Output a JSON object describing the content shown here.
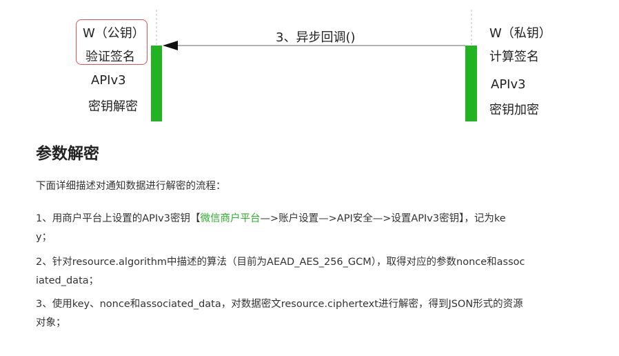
{
  "diagram": {
    "left": {
      "title": "W（公钥）",
      "action": "验证签名",
      "api": "APIv3",
      "op": "密钥解密"
    },
    "right": {
      "title": "W（私钥）",
      "action": "计算签名",
      "api": "APIv3",
      "op": "密钥加密"
    },
    "message": "3、异步回调()",
    "colors": {
      "bar": "#22b322",
      "highlight_border": "#e05252",
      "link": "#2bb02b"
    }
  },
  "section": {
    "title": "参数解密",
    "intro": "下面详细描述对通知数据进行解密的流程：",
    "step1": {
      "pre": "1、用商户平台上设置的APIv3密钥【",
      "link": "微信商户平台",
      "post_line1": "—>账户设置—>API安全—>设置APIv3密钥】，记为ke",
      "line2": "y；"
    },
    "step2": {
      "line1": "2、针对resource.algorithm中描述的算法（目前为AEAD_AES_256_GCM），取得对应的参数nonce和assoc",
      "line2": "iated_data；"
    },
    "step3": {
      "line1": "3、使用key、nonce和associated_data，对数据密文resource.ciphertext进行解密，得到JSON形式的资源",
      "line2": "对象；"
    }
  }
}
